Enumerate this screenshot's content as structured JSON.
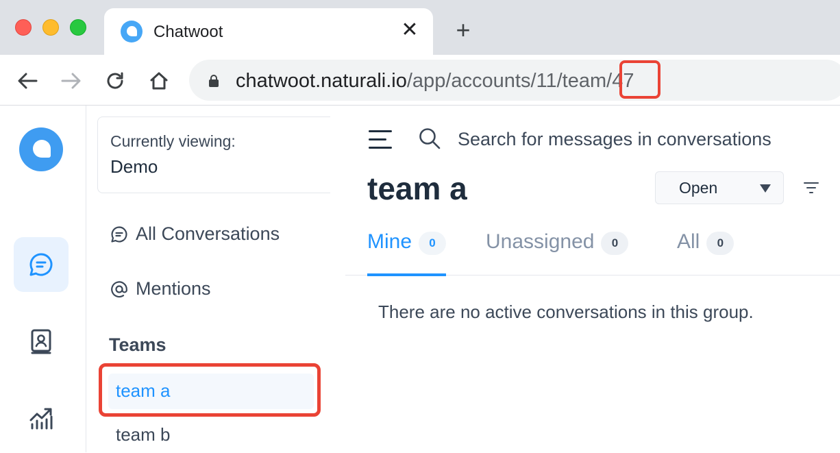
{
  "browser": {
    "tab_title": "Chatwoot",
    "tab_close": "✕",
    "new_tab": "+",
    "url_host": "chatwoot.naturali.io",
    "url_path_prefix": "/app/accounts/11/team/",
    "url_path_id": "47",
    "highlight_color": "#ea4335"
  },
  "sidebar": {
    "rail_items": [
      {
        "icon": "chat-bubble-icon",
        "active": true
      },
      {
        "icon": "contact-book-icon",
        "active": false
      },
      {
        "icon": "reports-chart-icon",
        "active": false
      }
    ],
    "currently_viewing_label": "Currently viewing:",
    "currently_viewing_value": "Demo",
    "menu": [
      {
        "icon": "chat-bubble-icon",
        "label": "All Conversations"
      },
      {
        "icon": "at-sign-icon",
        "label": "Mentions"
      }
    ],
    "teams_heading": "Teams",
    "teams": [
      {
        "label": "team a",
        "active": true
      },
      {
        "label": "team b",
        "active": false
      }
    ]
  },
  "main": {
    "search_placeholder": "Search for messages in conversations",
    "title": "team a",
    "status_filter": "Open",
    "tabs": [
      {
        "label": "Mine",
        "count": "0",
        "active": true
      },
      {
        "label": "Unassigned",
        "count": "0",
        "active": false
      },
      {
        "label": "All",
        "count": "0",
        "active": false
      }
    ],
    "empty_message": "There are no active conversations in this group."
  },
  "colors": {
    "accent": "#1f93ff",
    "brand": "#47a7f6",
    "text_dark": "#1f2d3d",
    "text_muted": "#8492a6"
  }
}
